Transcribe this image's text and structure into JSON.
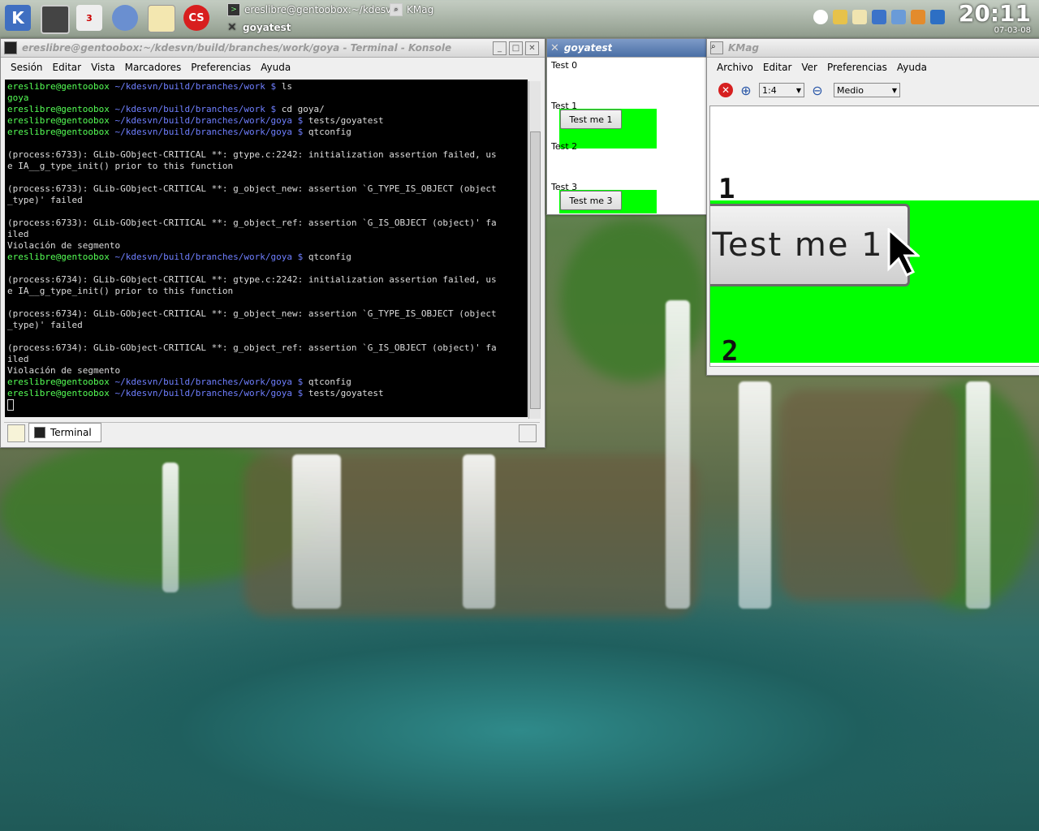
{
  "taskbar": {
    "launchers": [
      {
        "icon": "kde-menu-icon"
      },
      {
        "icon": "computer-icon"
      },
      {
        "icon": "calendar-icon",
        "badge": "3"
      },
      {
        "icon": "network-globe-icon"
      },
      {
        "icon": "text-editor-icon"
      },
      {
        "icon": "lastfm-icon",
        "label": "CS"
      }
    ],
    "tasks": [
      {
        "label": "ereslibre@gentoobox:~/kdesv"
      },
      {
        "label": "KMag"
      },
      {
        "label": "goyatest"
      }
    ],
    "clock_time": "20:11",
    "clock_date": "07-03-08"
  },
  "konsole": {
    "title": "ereslibre@gentoobox:~/kdesvn/build/branches/work/goya - Terminal - Konsole",
    "menu": [
      "Sesión",
      "Editar",
      "Vista",
      "Marcadores",
      "Preferencias",
      "Ayuda"
    ],
    "tab_label": "Terminal",
    "lines": [
      {
        "user": "ereslibre@gentoobox",
        "path": " ~/kdesvn/build/branches/work $ ",
        "cmd": "ls"
      },
      {
        "plain_green": "goya"
      },
      {
        "user": "ereslibre@gentoobox",
        "path": " ~/kdesvn/build/branches/work $ ",
        "cmd": "cd goya/"
      },
      {
        "user": "ereslibre@gentoobox",
        "path": " ~/kdesvn/build/branches/work/goya $ ",
        "cmd": "tests/goyatest"
      },
      {
        "user": "ereslibre@gentoobox",
        "path": " ~/kdesvn/build/branches/work/goya $ ",
        "cmd": "qtconfig"
      },
      {
        "text": ""
      },
      {
        "text": "(process:6733): GLib-GObject-CRITICAL **: gtype.c:2242: initialization assertion failed, us"
      },
      {
        "text": "e IA__g_type_init() prior to this function"
      },
      {
        "text": ""
      },
      {
        "text": "(process:6733): GLib-GObject-CRITICAL **: g_object_new: assertion `G_TYPE_IS_OBJECT (object"
      },
      {
        "text": "_type)' failed"
      },
      {
        "text": ""
      },
      {
        "text": "(process:6733): GLib-GObject-CRITICAL **: g_object_ref: assertion `G_IS_OBJECT (object)' fa"
      },
      {
        "text": "iled"
      },
      {
        "text": "Violación de segmento"
      },
      {
        "user": "ereslibre@gentoobox",
        "path": " ~/kdesvn/build/branches/work/goya $ ",
        "cmd": "qtconfig"
      },
      {
        "text": ""
      },
      {
        "text": "(process:6734): GLib-GObject-CRITICAL **: gtype.c:2242: initialization assertion failed, us"
      },
      {
        "text": "e IA__g_type_init() prior to this function"
      },
      {
        "text": ""
      },
      {
        "text": "(process:6734): GLib-GObject-CRITICAL **: g_object_new: assertion `G_TYPE_IS_OBJECT (object"
      },
      {
        "text": "_type)' failed"
      },
      {
        "text": ""
      },
      {
        "text": "(process:6734): GLib-GObject-CRITICAL **: g_object_ref: assertion `G_IS_OBJECT (object)' fa"
      },
      {
        "text": "iled"
      },
      {
        "text": "Violación de segmento"
      },
      {
        "user": "ereslibre@gentoobox",
        "path": " ~/kdesvn/build/branches/work/goya $ ",
        "cmd": "qtconfig"
      },
      {
        "user": "ereslibre@gentoobox",
        "path": " ~/kdesvn/build/branches/work/goya $ ",
        "cmd": "tests/goyatest"
      }
    ]
  },
  "goyatest": {
    "title": "goyatest",
    "labels": [
      "Test 0",
      "Test 1",
      "Test 2",
      "Test 3"
    ],
    "buttons": [
      "Test me 1",
      "Test me 3"
    ]
  },
  "kmag": {
    "title": "KMag",
    "menu": [
      "Archivo",
      "Editar",
      "Ver",
      "Preferencias",
      "Ayuda"
    ],
    "zoom_value": "1:4",
    "quality_value": "Medio",
    "magnified_button_label": "Test me 1",
    "magnified_digits": [
      "1",
      "2"
    ]
  }
}
